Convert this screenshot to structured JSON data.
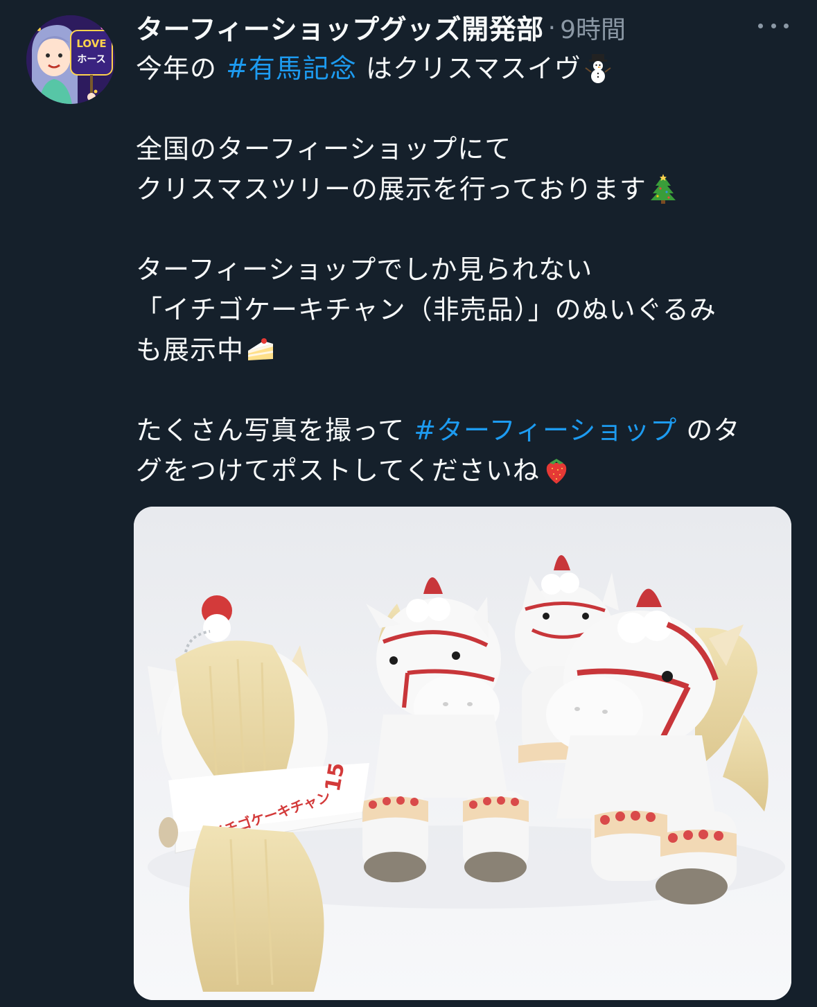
{
  "author": {
    "display_name": "ターフィーショップグッズ開発部",
    "separator": "·",
    "time_ago": "9時間",
    "avatar_text_top": "LOVE",
    "avatar_text_bottom": "ホース"
  },
  "tweet": {
    "l1_prefix": "今年の ",
    "l1_hashtag": "#有馬記念",
    "l1_suffix": " はクリスマスイヴ",
    "l2": "全国のターフィーショップにて",
    "l3": "クリスマスツリーの展示を行っております",
    "l4": "ターフィーショップでしか見られない",
    "l5": "「イチゴケーキチャン（非売品）」のぬいぐるみ",
    "l6": "も展示中",
    "l7_prefix": "たくさん写真を撮って ",
    "l7_hashtag": "#ターフィーショップ",
    "l7_suffix": " のタ",
    "l8": "グをつけてポストしてくださいね"
  },
  "media": {
    "sash_text": "イチゴケーキチャン",
    "sash_number": "15"
  },
  "icons": [
    "snowman-emoji",
    "christmas-tree-emoji",
    "shortcake-emoji",
    "strawberry-emoji",
    "more-icon"
  ],
  "colors": {
    "background": "#15202b",
    "text": "#f7f9f9",
    "secondary": "#8b98a5",
    "hashtag": "#1d9bf0"
  }
}
